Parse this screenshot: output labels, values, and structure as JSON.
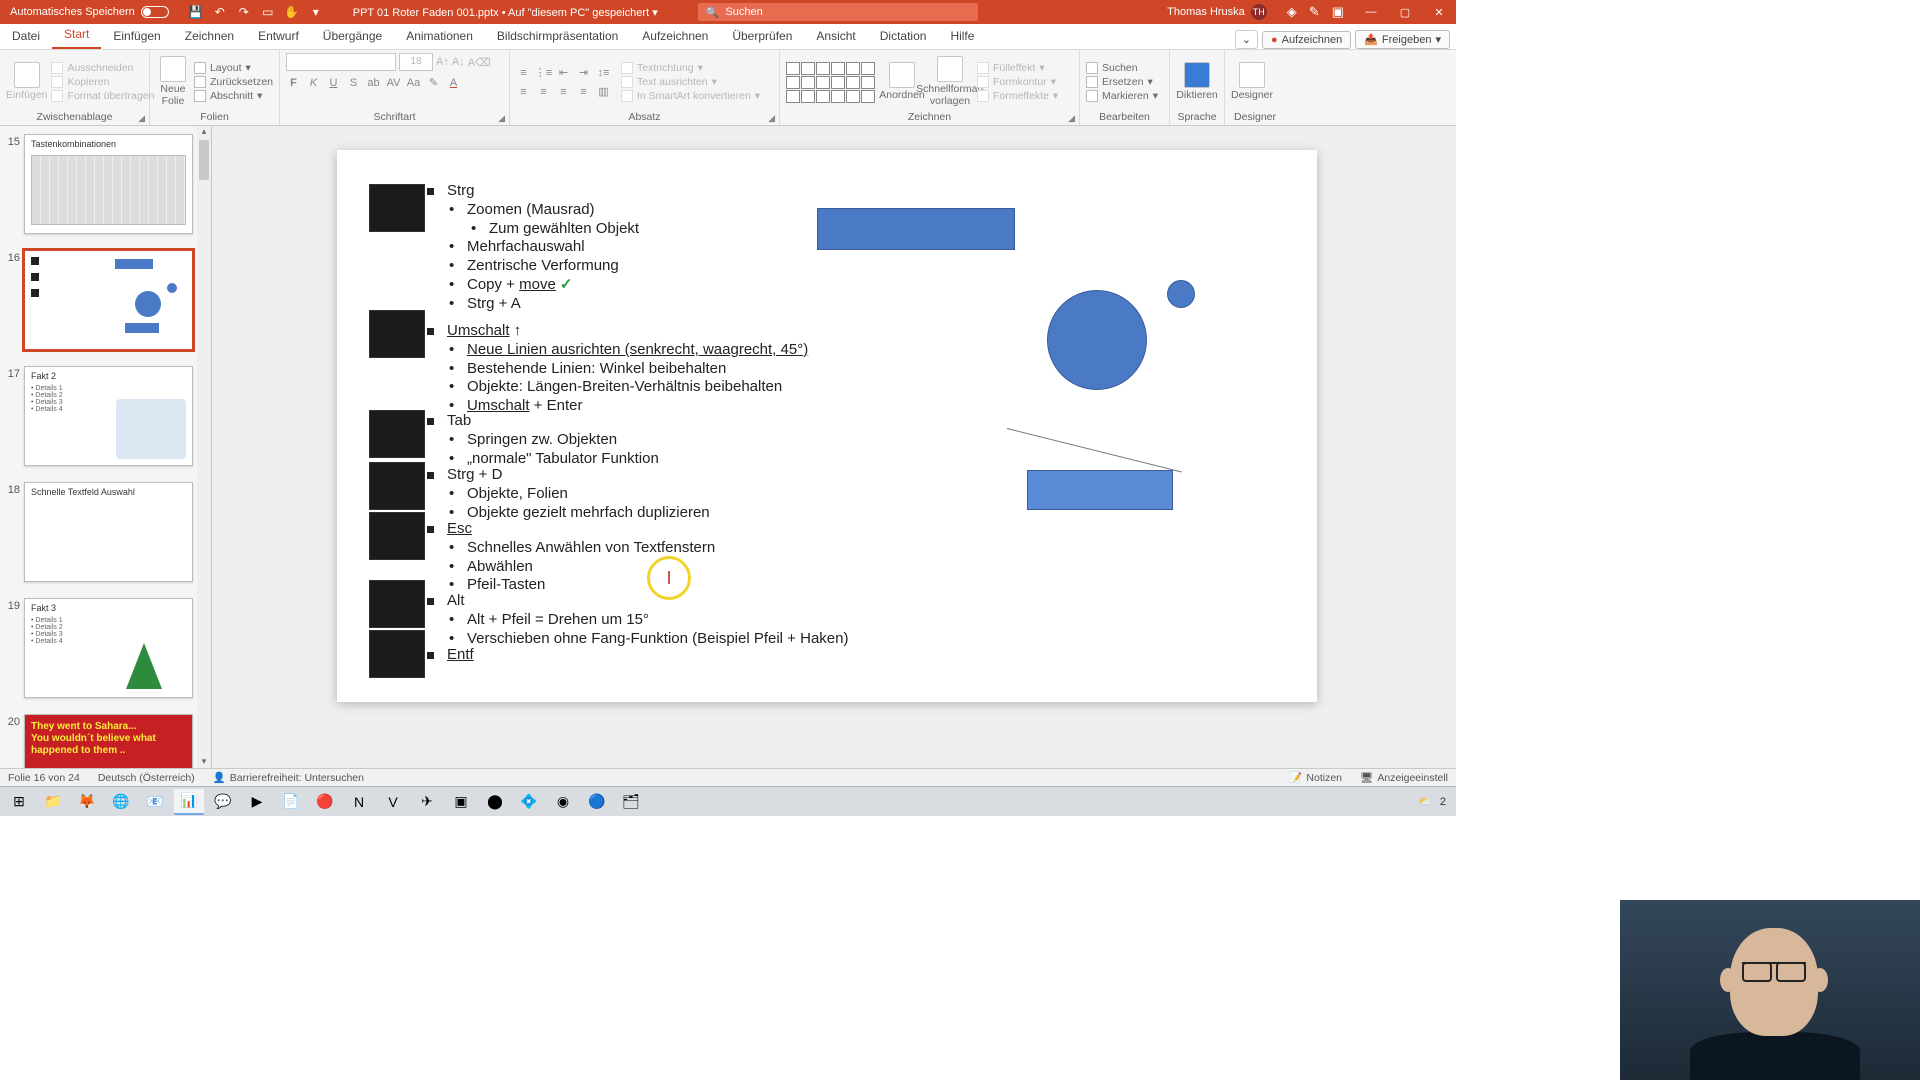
{
  "titlebar": {
    "autosave_label": "Automatisches Speichern",
    "filename": "PPT 01 Roter Faden 001.pptx • Auf \"diesem PC\" gespeichert",
    "search_placeholder": "Suchen",
    "user_name": "Thomas Hruska",
    "user_initials": "TH"
  },
  "tabs": {
    "items": [
      "Datei",
      "Start",
      "Einfügen",
      "Zeichnen",
      "Entwurf",
      "Übergänge",
      "Animationen",
      "Bildschirmpräsentation",
      "Aufzeichnen",
      "Überprüfen",
      "Ansicht",
      "Dictation",
      "Hilfe"
    ],
    "active_index": 1,
    "record_btn": "Aufzeichnen",
    "share_btn": "Freigeben"
  },
  "ribbon": {
    "clipboard": {
      "label": "Zwischenablage",
      "paste": "Einfügen",
      "cut": "Ausschneiden",
      "copy": "Kopieren",
      "format": "Format übertragen"
    },
    "slides": {
      "label": "Folien",
      "new_slide": "Neue Folie",
      "layout": "Layout",
      "reset": "Zurücksetzen",
      "section": "Abschnitt"
    },
    "font": {
      "label": "Schriftart"
    },
    "paragraph": {
      "label": "Absatz",
      "textdir": "Textrichtung",
      "align": "Text ausrichten",
      "smartart": "In SmartArt konvertieren"
    },
    "drawing": {
      "label": "Zeichnen",
      "arrange": "Anordnen",
      "quick": "Schnellformat-vorlagen",
      "fill": "Fülleffekt",
      "outline": "Formkontur",
      "effects": "Formeffekte"
    },
    "editing": {
      "label": "Bearbeiten",
      "find": "Suchen",
      "replace": "Ersetzen",
      "select": "Markieren"
    },
    "voice": {
      "label": "Sprache",
      "dictate": "Diktieren"
    },
    "designer": {
      "label": "Designer",
      "btn": "Designer"
    }
  },
  "thumbnails": [
    {
      "num": "15",
      "title": "Tastenkombinationen"
    },
    {
      "num": "16",
      "title": ""
    },
    {
      "num": "17",
      "title": "Fakt 2"
    },
    {
      "num": "18",
      "title": "Schnelle Textfeld Auswahl"
    },
    {
      "num": "19",
      "title": "Fakt 3"
    },
    {
      "num": "20",
      "title": ""
    }
  ],
  "thumb20": {
    "line1": "They went to Sahara...",
    "line2": "You wouldn´t believe what",
    "line3": "happened to them .."
  },
  "active_thumb": 1,
  "slide": {
    "strg_head": "Strg",
    "strg": [
      "Zoomen (Mausrad)",
      "Zum gewählten Objekt",
      "Mehrfachauswahl",
      "Zentrische Verformung",
      "Copy + move",
      "Strg + A"
    ],
    "umschalt_head": "Umschalt",
    "umschalt": [
      "Neue Linien ausrichten (senkrecht, waagrecht, 45°)",
      "Bestehende Linien: Winkel beibehalten",
      "Objekte: Längen-Breiten-Verhältnis beibehalten",
      "Umschalt + Enter"
    ],
    "tab_head": "Tab",
    "tab": [
      "Springen zw. Objekten",
      "„normale\" Tabulator Funktion"
    ],
    "strgd_head": "Strg + D",
    "strgd": [
      "Objekte, Folien",
      "Objekte gezielt mehrfach duplizieren"
    ],
    "esc_head": "Esc",
    "esc": [
      "Schnelles Anwählen von Textfenstern",
      "Abwählen",
      "Pfeil-Tasten"
    ],
    "alt_head": "Alt",
    "alt": [
      "Alt + Pfeil = Drehen um 15°",
      "Verschieben ohne Fang-Funktion (Beispiel Pfeil + Haken)"
    ],
    "entf_head": "Entf",
    "copy_word": "Copy + ",
    "move_word": "move",
    "umschalt_enter_pre": "Umschalt",
    "umschalt_enter_post": " + Enter",
    "cursor_char": "I"
  },
  "statusbar": {
    "slide_of": "Folie 16 von 24",
    "lang": "Deutsch (Österreich)",
    "access": "Barrierefreiheit: Untersuchen",
    "notes": "Notizen",
    "display": "Anzeigeeinstell"
  },
  "taskbar": {
    "temp": "2"
  }
}
